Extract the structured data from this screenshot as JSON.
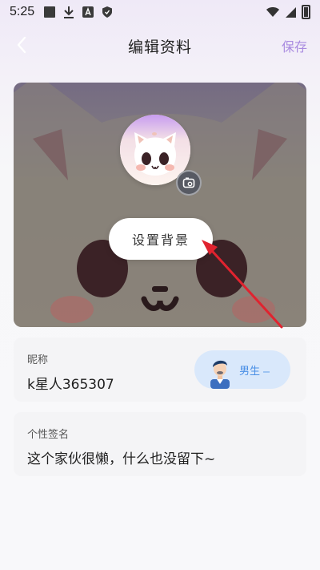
{
  "status_bar": {
    "time": "5:25"
  },
  "nav": {
    "title": "编辑资料",
    "save_label": "保存"
  },
  "cover": {
    "set_background_label": "设置背景"
  },
  "profile": {
    "nickname_label": "昵称",
    "nickname_value": "k星人365307",
    "gender_label": "男生",
    "signature_label": "个性签名",
    "signature_value": "这个家伙很懒，什么也没留下~"
  },
  "colors": {
    "accent": "#a98be0",
    "gender_pill": "#d9e8fb",
    "gender_text": "#4a8fe6",
    "annotation_arrow": "#e0232f"
  },
  "icons": {
    "back": "chevron-left-icon",
    "camera": "camera-icon",
    "wifi": "wifi-icon",
    "signal": "signal-icon",
    "battery": "battery-icon"
  }
}
